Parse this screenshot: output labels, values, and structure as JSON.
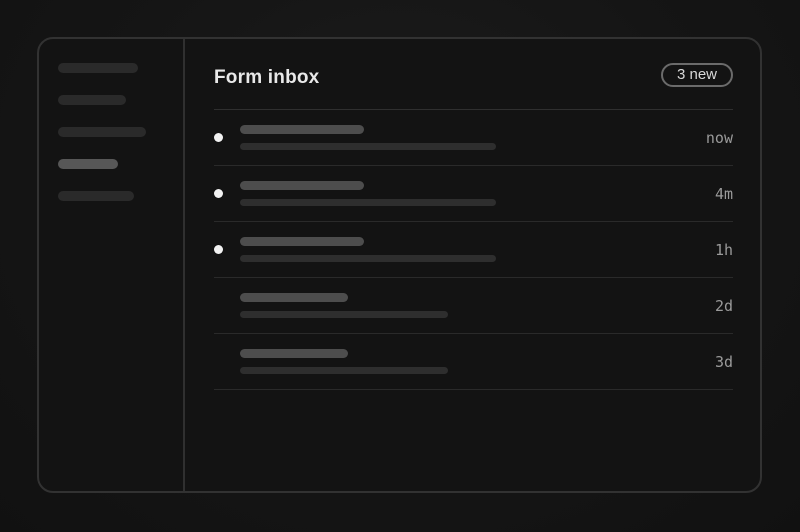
{
  "header": {
    "title": "Form inbox",
    "badge": "3 new"
  },
  "sidebar": {
    "items": [
      {
        "state": "default"
      },
      {
        "state": "default"
      },
      {
        "state": "default"
      },
      {
        "state": "active"
      },
      {
        "state": "default"
      }
    ]
  },
  "inbox": {
    "items": [
      {
        "unread": true,
        "time": "now"
      },
      {
        "unread": true,
        "time": "4m"
      },
      {
        "unread": true,
        "time": "1h"
      },
      {
        "unread": false,
        "time": "2d"
      },
      {
        "unread": false,
        "time": "3d"
      }
    ]
  },
  "colors": {
    "background": "#161616",
    "panel": "#131313",
    "border": "#323232",
    "unread_dot": "#f2f2f2",
    "title_text": "#e9e9e9",
    "muted_text": "#9a9a9a"
  }
}
